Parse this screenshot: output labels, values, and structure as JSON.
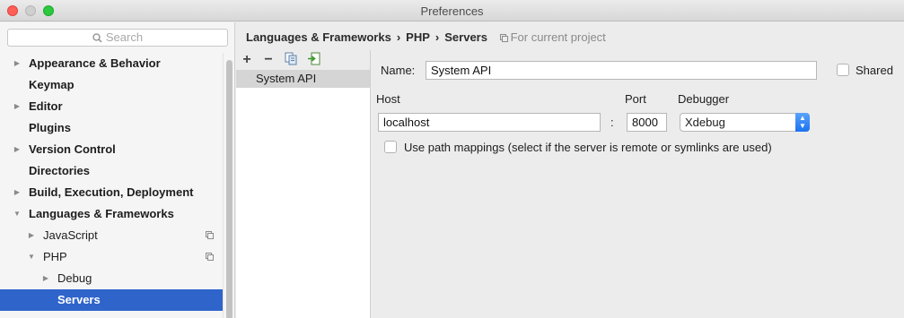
{
  "window": {
    "title": "Preferences"
  },
  "search": {
    "placeholder": "Search"
  },
  "sidebar": {
    "items": [
      {
        "label": "Appearance & Behavior",
        "arrow": "▶"
      },
      {
        "label": "Keymap",
        "arrow": ""
      },
      {
        "label": "Editor",
        "arrow": "▶"
      },
      {
        "label": "Plugins",
        "arrow": ""
      },
      {
        "label": "Version Control",
        "arrow": "▶"
      },
      {
        "label": "Directories",
        "arrow": ""
      },
      {
        "label": "Build, Execution, Deployment",
        "arrow": "▶"
      },
      {
        "label": "Languages & Frameworks",
        "arrow": "▼"
      },
      {
        "label": "JavaScript",
        "arrow": "▶"
      },
      {
        "label": "PHP",
        "arrow": "▼"
      },
      {
        "label": "Debug",
        "arrow": "▶"
      },
      {
        "label": "Servers",
        "arrow": ""
      }
    ]
  },
  "breadcrumb": {
    "part1": "Languages & Frameworks",
    "sep1": "›",
    "part2": "PHP",
    "sep2": "›",
    "part3": "Servers",
    "note": "For current project"
  },
  "toolbar": {
    "add": "+",
    "remove": "−"
  },
  "servers": {
    "items": [
      "System API"
    ]
  },
  "form": {
    "name_label": "Name:",
    "name_value": "System API",
    "shared_label": "Shared",
    "host_label": "Host",
    "host_value": "localhost",
    "colon": ":",
    "port_label": "Port",
    "port_value": "8000",
    "debugger_label": "Debugger",
    "debugger_value": "Xdebug",
    "path_mappings_label": "Use path mappings (select if the server is remote or symlinks are used)"
  },
  "colors": {
    "selection": "#2f64cb",
    "accent": "#1a72f0"
  }
}
